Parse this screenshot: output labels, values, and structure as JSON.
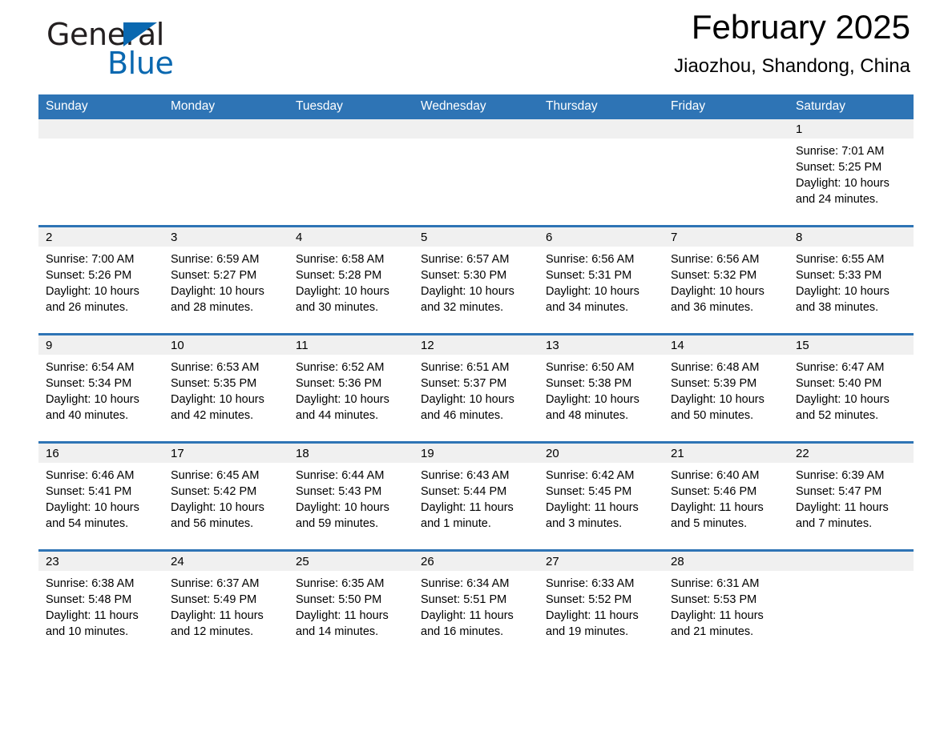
{
  "brand": {
    "name_part1": "General",
    "name_part2": "Blue",
    "accent_color": "#0a68b0"
  },
  "header": {
    "title": "February 2025",
    "subtitle": "Jiaozhou, Shandong, China"
  },
  "theme": {
    "header_blue": "#2e74b5",
    "daynum_band": "#f0f0f0",
    "text": "#000000"
  },
  "weekday_headers": [
    "Sunday",
    "Monday",
    "Tuesday",
    "Wednesday",
    "Thursday",
    "Friday",
    "Saturday"
  ],
  "labels": {
    "sunrise_prefix": "Sunrise:",
    "sunset_prefix": "Sunset:",
    "daylight_prefix": "Daylight:"
  },
  "weeks": [
    [
      {
        "day": "",
        "line1": "",
        "line2": "",
        "line3": "",
        "line4": "",
        "empty": true
      },
      {
        "day": "",
        "line1": "",
        "line2": "",
        "line3": "",
        "line4": "",
        "empty": true
      },
      {
        "day": "",
        "line1": "",
        "line2": "",
        "line3": "",
        "line4": "",
        "empty": true
      },
      {
        "day": "",
        "line1": "",
        "line2": "",
        "line3": "",
        "line4": "",
        "empty": true
      },
      {
        "day": "",
        "line1": "",
        "line2": "",
        "line3": "",
        "line4": "",
        "empty": true
      },
      {
        "day": "",
        "line1": "",
        "line2": "",
        "line3": "",
        "line4": "",
        "empty": true
      },
      {
        "day": "1",
        "line1": "Sunrise: 7:01 AM",
        "line2": "Sunset: 5:25 PM",
        "line3": "Daylight: 10 hours",
        "line4": "and 24 minutes.",
        "empty": false
      }
    ],
    [
      {
        "day": "2",
        "line1": "Sunrise: 7:00 AM",
        "line2": "Sunset: 5:26 PM",
        "line3": "Daylight: 10 hours",
        "line4": "and 26 minutes.",
        "empty": false
      },
      {
        "day": "3",
        "line1": "Sunrise: 6:59 AM",
        "line2": "Sunset: 5:27 PM",
        "line3": "Daylight: 10 hours",
        "line4": "and 28 minutes.",
        "empty": false
      },
      {
        "day": "4",
        "line1": "Sunrise: 6:58 AM",
        "line2": "Sunset: 5:28 PM",
        "line3": "Daylight: 10 hours",
        "line4": "and 30 minutes.",
        "empty": false
      },
      {
        "day": "5",
        "line1": "Sunrise: 6:57 AM",
        "line2": "Sunset: 5:30 PM",
        "line3": "Daylight: 10 hours",
        "line4": "and 32 minutes.",
        "empty": false
      },
      {
        "day": "6",
        "line1": "Sunrise: 6:56 AM",
        "line2": "Sunset: 5:31 PM",
        "line3": "Daylight: 10 hours",
        "line4": "and 34 minutes.",
        "empty": false
      },
      {
        "day": "7",
        "line1": "Sunrise: 6:56 AM",
        "line2": "Sunset: 5:32 PM",
        "line3": "Daylight: 10 hours",
        "line4": "and 36 minutes.",
        "empty": false
      },
      {
        "day": "8",
        "line1": "Sunrise: 6:55 AM",
        "line2": "Sunset: 5:33 PM",
        "line3": "Daylight: 10 hours",
        "line4": "and 38 minutes.",
        "empty": false
      }
    ],
    [
      {
        "day": "9",
        "line1": "Sunrise: 6:54 AM",
        "line2": "Sunset: 5:34 PM",
        "line3": "Daylight: 10 hours",
        "line4": "and 40 minutes.",
        "empty": false
      },
      {
        "day": "10",
        "line1": "Sunrise: 6:53 AM",
        "line2": "Sunset: 5:35 PM",
        "line3": "Daylight: 10 hours",
        "line4": "and 42 minutes.",
        "empty": false
      },
      {
        "day": "11",
        "line1": "Sunrise: 6:52 AM",
        "line2": "Sunset: 5:36 PM",
        "line3": "Daylight: 10 hours",
        "line4": "and 44 minutes.",
        "empty": false
      },
      {
        "day": "12",
        "line1": "Sunrise: 6:51 AM",
        "line2": "Sunset: 5:37 PM",
        "line3": "Daylight: 10 hours",
        "line4": "and 46 minutes.",
        "empty": false
      },
      {
        "day": "13",
        "line1": "Sunrise: 6:50 AM",
        "line2": "Sunset: 5:38 PM",
        "line3": "Daylight: 10 hours",
        "line4": "and 48 minutes.",
        "empty": false
      },
      {
        "day": "14",
        "line1": "Sunrise: 6:48 AM",
        "line2": "Sunset: 5:39 PM",
        "line3": "Daylight: 10 hours",
        "line4": "and 50 minutes.",
        "empty": false
      },
      {
        "day": "15",
        "line1": "Sunrise: 6:47 AM",
        "line2": "Sunset: 5:40 PM",
        "line3": "Daylight: 10 hours",
        "line4": "and 52 minutes.",
        "empty": false
      }
    ],
    [
      {
        "day": "16",
        "line1": "Sunrise: 6:46 AM",
        "line2": "Sunset: 5:41 PM",
        "line3": "Daylight: 10 hours",
        "line4": "and 54 minutes.",
        "empty": false
      },
      {
        "day": "17",
        "line1": "Sunrise: 6:45 AM",
        "line2": "Sunset: 5:42 PM",
        "line3": "Daylight: 10 hours",
        "line4": "and 56 minutes.",
        "empty": false
      },
      {
        "day": "18",
        "line1": "Sunrise: 6:44 AM",
        "line2": "Sunset: 5:43 PM",
        "line3": "Daylight: 10 hours",
        "line4": "and 59 minutes.",
        "empty": false
      },
      {
        "day": "19",
        "line1": "Sunrise: 6:43 AM",
        "line2": "Sunset: 5:44 PM",
        "line3": "Daylight: 11 hours",
        "line4": "and 1 minute.",
        "empty": false
      },
      {
        "day": "20",
        "line1": "Sunrise: 6:42 AM",
        "line2": "Sunset: 5:45 PM",
        "line3": "Daylight: 11 hours",
        "line4": "and 3 minutes.",
        "empty": false
      },
      {
        "day": "21",
        "line1": "Sunrise: 6:40 AM",
        "line2": "Sunset: 5:46 PM",
        "line3": "Daylight: 11 hours",
        "line4": "and 5 minutes.",
        "empty": false
      },
      {
        "day": "22",
        "line1": "Sunrise: 6:39 AM",
        "line2": "Sunset: 5:47 PM",
        "line3": "Daylight: 11 hours",
        "line4": "and 7 minutes.",
        "empty": false
      }
    ],
    [
      {
        "day": "23",
        "line1": "Sunrise: 6:38 AM",
        "line2": "Sunset: 5:48 PM",
        "line3": "Daylight: 11 hours",
        "line4": "and 10 minutes.",
        "empty": false
      },
      {
        "day": "24",
        "line1": "Sunrise: 6:37 AM",
        "line2": "Sunset: 5:49 PM",
        "line3": "Daylight: 11 hours",
        "line4": "and 12 minutes.",
        "empty": false
      },
      {
        "day": "25",
        "line1": "Sunrise: 6:35 AM",
        "line2": "Sunset: 5:50 PM",
        "line3": "Daylight: 11 hours",
        "line4": "and 14 minutes.",
        "empty": false
      },
      {
        "day": "26",
        "line1": "Sunrise: 6:34 AM",
        "line2": "Sunset: 5:51 PM",
        "line3": "Daylight: 11 hours",
        "line4": "and 16 minutes.",
        "empty": false
      },
      {
        "day": "27",
        "line1": "Sunrise: 6:33 AM",
        "line2": "Sunset: 5:52 PM",
        "line3": "Daylight: 11 hours",
        "line4": "and 19 minutes.",
        "empty": false
      },
      {
        "day": "28",
        "line1": "Sunrise: 6:31 AM",
        "line2": "Sunset: 5:53 PM",
        "line3": "Daylight: 11 hours",
        "line4": "and 21 minutes.",
        "empty": false
      },
      {
        "day": "",
        "line1": "",
        "line2": "",
        "line3": "",
        "line4": "",
        "empty": true
      }
    ]
  ]
}
